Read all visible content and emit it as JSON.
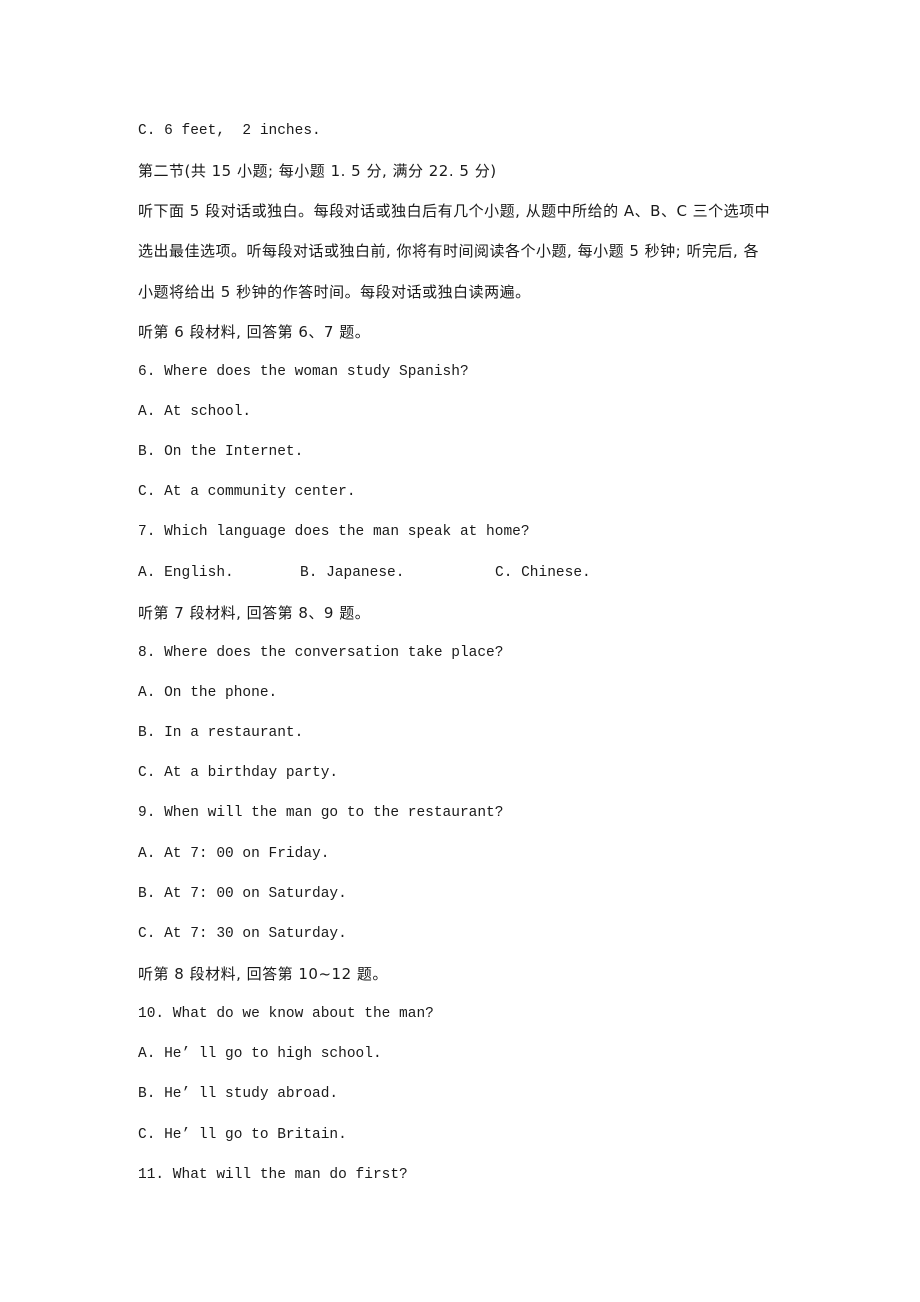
{
  "document": {
    "lines": [
      {
        "type": "option",
        "text": "C. 6 feet,  2 inches."
      },
      {
        "type": "section-header",
        "text": "第二节(共 15 小题; 每小题 1. 5 分, 满分 22. 5 分)"
      },
      {
        "type": "instruction",
        "text": "听下面 5 段对话或独白。每段对话或独白后有几个小题, 从题中所给的 A、B、C 三个选项中"
      },
      {
        "type": "instruction",
        "text": "选出最佳选项。听每段对话或独白前, 你将有时间阅读各个小题, 每小题 5 秒钟; 听完后, 各"
      },
      {
        "type": "instruction",
        "text": "小题将给出 5 秒钟的作答时间。每段对话或独白读两遍。"
      },
      {
        "type": "material-header",
        "text": "听第 6 段材料, 回答第 6、7 题。"
      },
      {
        "type": "question",
        "text": "6. Where does the woman study Spanish?"
      },
      {
        "type": "option",
        "text": "A. At school."
      },
      {
        "type": "option",
        "text": "B. On the Internet."
      },
      {
        "type": "option",
        "text": "C. At a community center."
      },
      {
        "type": "question",
        "text": "7. Which language does the man speak at home?"
      }
    ],
    "q7_options": {
      "a": "A. English.",
      "b": "B. Japanese.",
      "c": "C. Chinese."
    },
    "lines2": [
      {
        "type": "material-header",
        "text": "听第 7 段材料, 回答第 8、9 题。"
      },
      {
        "type": "question",
        "text": "8. Where does the conversation take place?"
      },
      {
        "type": "option",
        "text": "A. On the phone."
      },
      {
        "type": "option",
        "text": "B. In a restaurant."
      },
      {
        "type": "option",
        "text": "C. At a birthday party."
      },
      {
        "type": "question",
        "text": "9. When will the man go to the restaurant?"
      },
      {
        "type": "option",
        "text": "A. At 7: 00 on Friday."
      },
      {
        "type": "option",
        "text": "B. At 7: 00 on Saturday."
      },
      {
        "type": "option",
        "text": "C. At 7: 30 on Saturday."
      },
      {
        "type": "material-header",
        "text": "听第 8 段材料, 回答第 10~12 题。"
      },
      {
        "type": "question",
        "text": "10. What do we know about the man?"
      },
      {
        "type": "option",
        "text": "A. He’ ll go to high school."
      },
      {
        "type": "option",
        "text": "B. He’ ll study abroad."
      },
      {
        "type": "option",
        "text": "C. He’ ll go to Britain."
      },
      {
        "type": "question",
        "text": "11. What will the man do first?"
      }
    ]
  }
}
